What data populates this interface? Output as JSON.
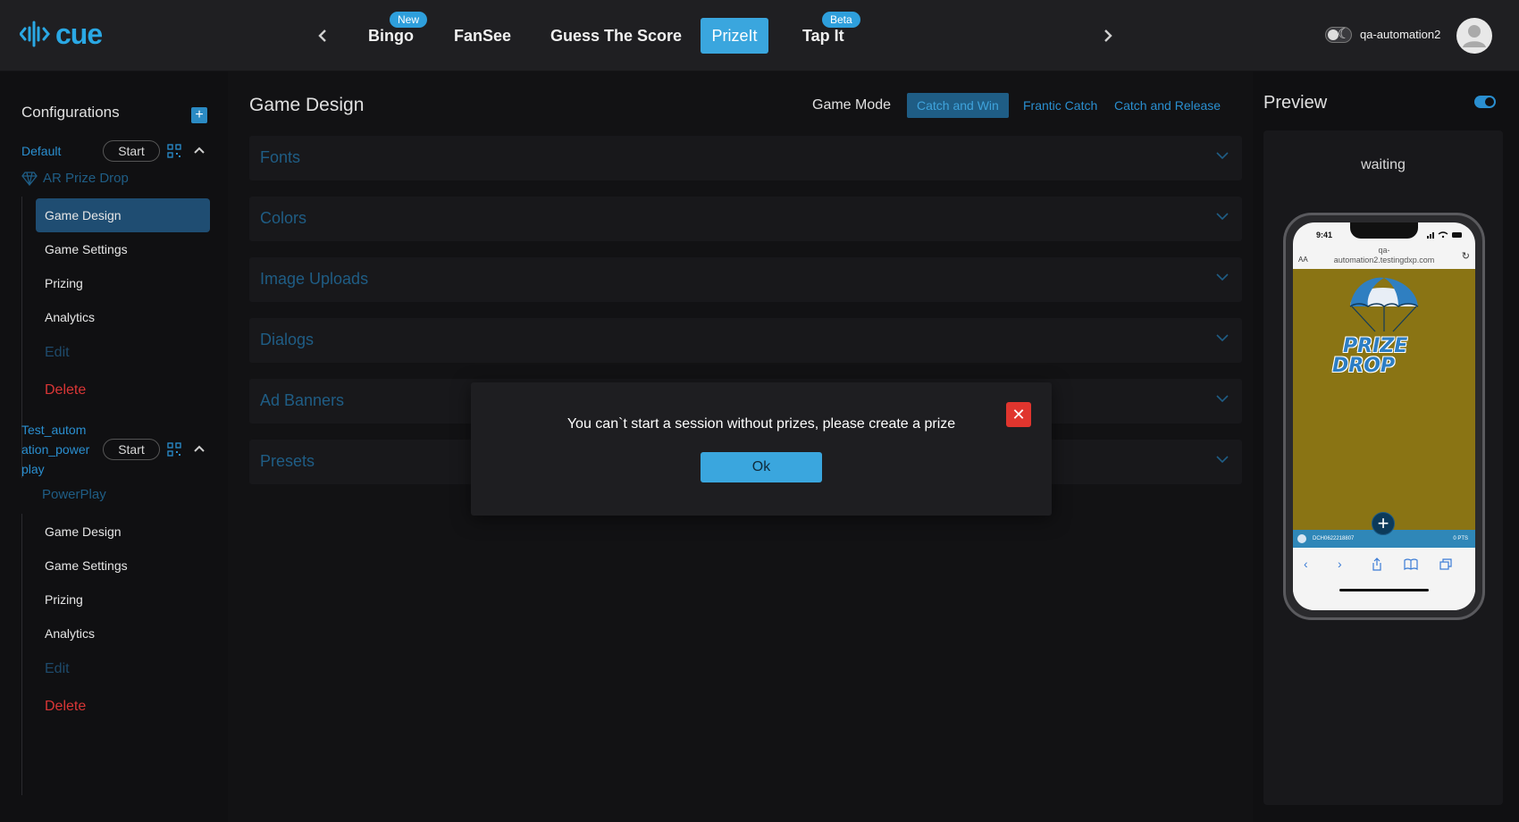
{
  "app": {
    "logo_text": "cue",
    "brand_color": "#2aa8e4"
  },
  "header": {
    "tabs": [
      {
        "label": "Bingo",
        "badge": "New"
      },
      {
        "label": "FanSee",
        "badge": null
      },
      {
        "label": "Guess The Score",
        "badge": null
      },
      {
        "label": "PrizeIt",
        "badge": null
      },
      {
        "label": "Tap It",
        "badge": "Beta"
      }
    ],
    "active_tab": "PrizeIt",
    "username": "qa-automation2"
  },
  "sidebar": {
    "title": "Configurations",
    "configs": [
      {
        "name": "Default",
        "start_label": "Start",
        "game_type": "AR Prize Drop",
        "items": [
          "Game Design",
          "Game Settings",
          "Prizing",
          "Analytics",
          "Edit",
          "Delete"
        ],
        "active_item": "Game Design"
      },
      {
        "name_lines": [
          "Test_autom",
          "ation_power",
          "play"
        ],
        "start_label": "Start",
        "game_type": "PowerPlay",
        "items": [
          "Game Design",
          "Game Settings",
          "Prizing",
          "Analytics",
          "Edit",
          "Delete"
        ]
      }
    ]
  },
  "main": {
    "title": "Game Design",
    "game_mode_label": "Game Mode",
    "game_modes": [
      "Catch and Win",
      "Frantic Catch",
      "Catch and Release"
    ],
    "active_mode": "Catch and Win",
    "sections": [
      "Fonts",
      "Colors",
      "Image Uploads",
      "Dialogs",
      "Ad Banners",
      "Presets"
    ]
  },
  "preview": {
    "title": "Preview",
    "status": "waiting",
    "phone": {
      "time": "9:41",
      "url_line1": "qa-",
      "url_line2": "automation2.testingdxp.com",
      "aa": "AA",
      "game_logo_line1": "PRIZE",
      "game_logo_line2": "DROP",
      "bottom_left": "DCH0622218807",
      "bottom_right": "0 PTS"
    }
  },
  "modal": {
    "message": "You can`t start a session without prizes, please create a prize",
    "ok_label": "Ok"
  }
}
